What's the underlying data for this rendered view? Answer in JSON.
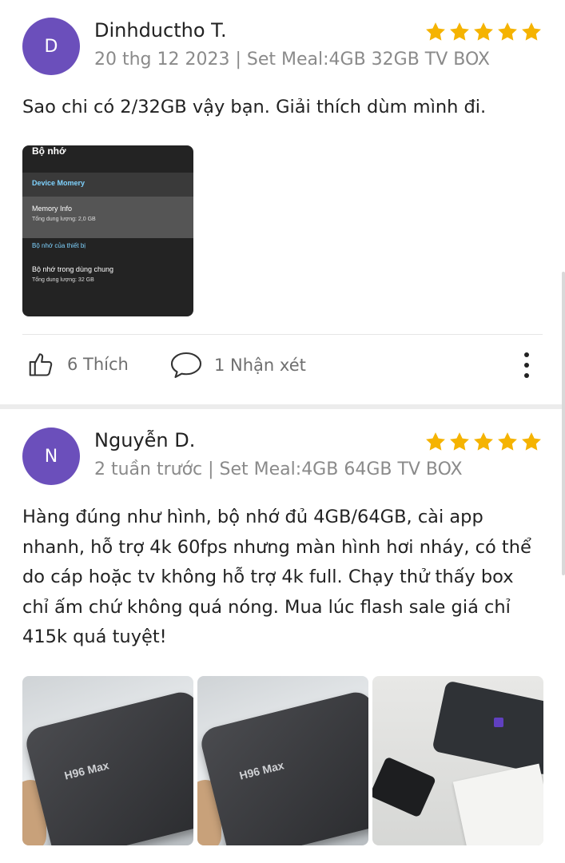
{
  "reviews": [
    {
      "avatar_letter": "D",
      "name": "Dinhductho T.",
      "meta": "20 thg 12 2023 | Set Meal:4GB 32GB TV BOX",
      "rating": 5,
      "text": "Sao chi có 2/32GB vậy bạn. Giải thích dùm mình đi.",
      "photo_texts": {
        "title": "Bộ nhớ",
        "device_memory": "Device Momery",
        "memory_info": "Memory Info",
        "total1": "Tổng dung lượng: 2,0 GB",
        "device_storage": "Bộ nhớ của thiết bị",
        "shared_storage": "Bộ nhớ trong dùng chung",
        "total2": "Tổng dung lượng: 32 GB"
      },
      "likes_label": "6 Thích",
      "comments_label": "1 Nhận xét"
    },
    {
      "avatar_letter": "N",
      "name": "Nguyễn D.",
      "meta": "2 tuần trước | Set Meal:4GB 64GB TV BOX",
      "rating": 5,
      "text_lines": [
        "Hàng đúng như hình, bộ nhớ đủ 4GB/64GB, cài app",
        "nhanh, hỗ trợ 4k 60fps nhưng màn hình hơi nháy, có thể",
        "do cáp hoặc tv không hỗ trợ 4k full. Chạy thử thấy box",
        "chỉ ấm chứ không quá nóng. Mua lúc flash sale giá chỉ",
        "415k quá tuyệt!"
      ],
      "photo_logo": "H96 Max"
    }
  ],
  "colors": {
    "avatar": "#6b4fbb",
    "star": "#f5b301",
    "meta": "#8a8a8a"
  }
}
